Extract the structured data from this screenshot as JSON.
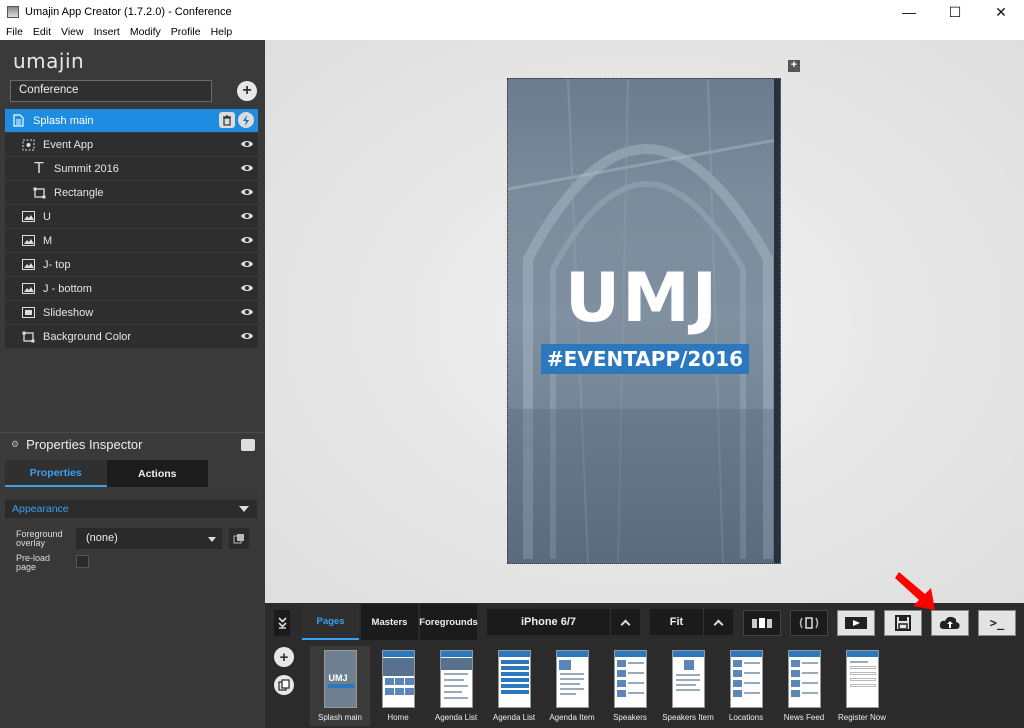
{
  "window": {
    "title": "Umajin App Creator (1.7.2.0) - Conference",
    "minimize": "—",
    "maximize": "☐",
    "close": "✕"
  },
  "menu": [
    "File",
    "Edit",
    "View",
    "Insert",
    "Modify",
    "Profile",
    "Help"
  ],
  "sidebar": {
    "logo": "umajin",
    "project": "Conference",
    "layers": [
      {
        "label": "Splash main",
        "icon": "page-icon",
        "indent": 0,
        "selected": true
      },
      {
        "label": "Event App",
        "icon": "group-icon",
        "indent": 1
      },
      {
        "label": "Summit 2016",
        "icon": "text-icon",
        "indent": 2
      },
      {
        "label": "Rectangle",
        "icon": "rectangle-icon",
        "indent": 2
      },
      {
        "label": "U",
        "icon": "image-icon",
        "indent": 1
      },
      {
        "label": "M",
        "icon": "image-icon",
        "indent": 1
      },
      {
        "label": "J- top",
        "icon": "image-icon",
        "indent": 1
      },
      {
        "label": "J - bottom",
        "icon": "image-icon",
        "indent": 1
      },
      {
        "label": "Slideshow",
        "icon": "slideshow-icon",
        "indent": 1
      },
      {
        "label": "Background Color",
        "icon": "rectangle-icon",
        "indent": 1
      }
    ]
  },
  "inspector": {
    "title": "Properties Inspector",
    "tabs": [
      "Properties",
      "Actions"
    ],
    "section": "Appearance",
    "foreground_label": "Foreground overlay",
    "foreground_value": "(none)",
    "preload_label": "Pre-load page"
  },
  "canvas": {
    "headline": "UMJ",
    "hashtag": "#EVENTAPP/2016"
  },
  "toolbar": {
    "tabs": [
      "Pages",
      "Masters",
      "Foregrounds"
    ],
    "device": "iPhone 6/7",
    "zoom": "Fit",
    "console": ">_"
  },
  "pages": [
    {
      "label": "Splash main",
      "selected": true
    },
    {
      "label": "Home"
    },
    {
      "label": "Agenda List"
    },
    {
      "label": "Agenda List"
    },
    {
      "label": "Agenda Item"
    },
    {
      "label": "Speakers"
    },
    {
      "label": "Speakers Item"
    },
    {
      "label": "Locations"
    },
    {
      "label": "News Feed"
    },
    {
      "label": "Register Now"
    }
  ],
  "colors": {
    "accent": "#1e8ce0",
    "panel": "#3a3a3a",
    "hashtag_bg": "#2b78bf",
    "arrow": "#ff0000"
  }
}
